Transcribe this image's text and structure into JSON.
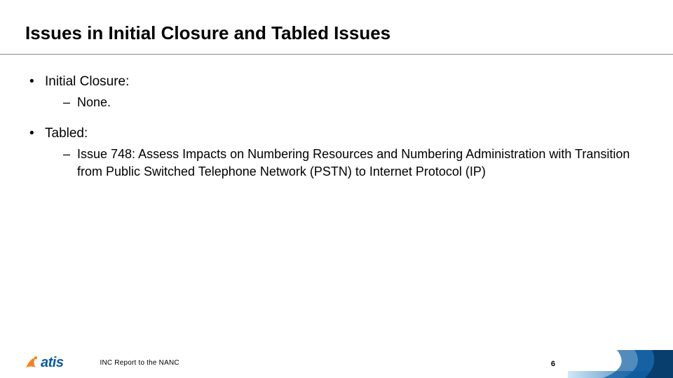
{
  "title": "Issues in Initial Closure and Tabled Issues",
  "sections": [
    {
      "heading": "Initial Closure:",
      "items": [
        "None."
      ]
    },
    {
      "heading": "Tabled:",
      "items": [
        "Issue 748: Assess Impacts on Numbering Resources and Numbering Administration with Transition from Public Switched Telephone Network (PSTN) to Internet Protocol (IP)"
      ]
    }
  ],
  "footer": {
    "logo_text": "atis",
    "report_label": "INC Report to the NANC",
    "page_number": "6"
  }
}
